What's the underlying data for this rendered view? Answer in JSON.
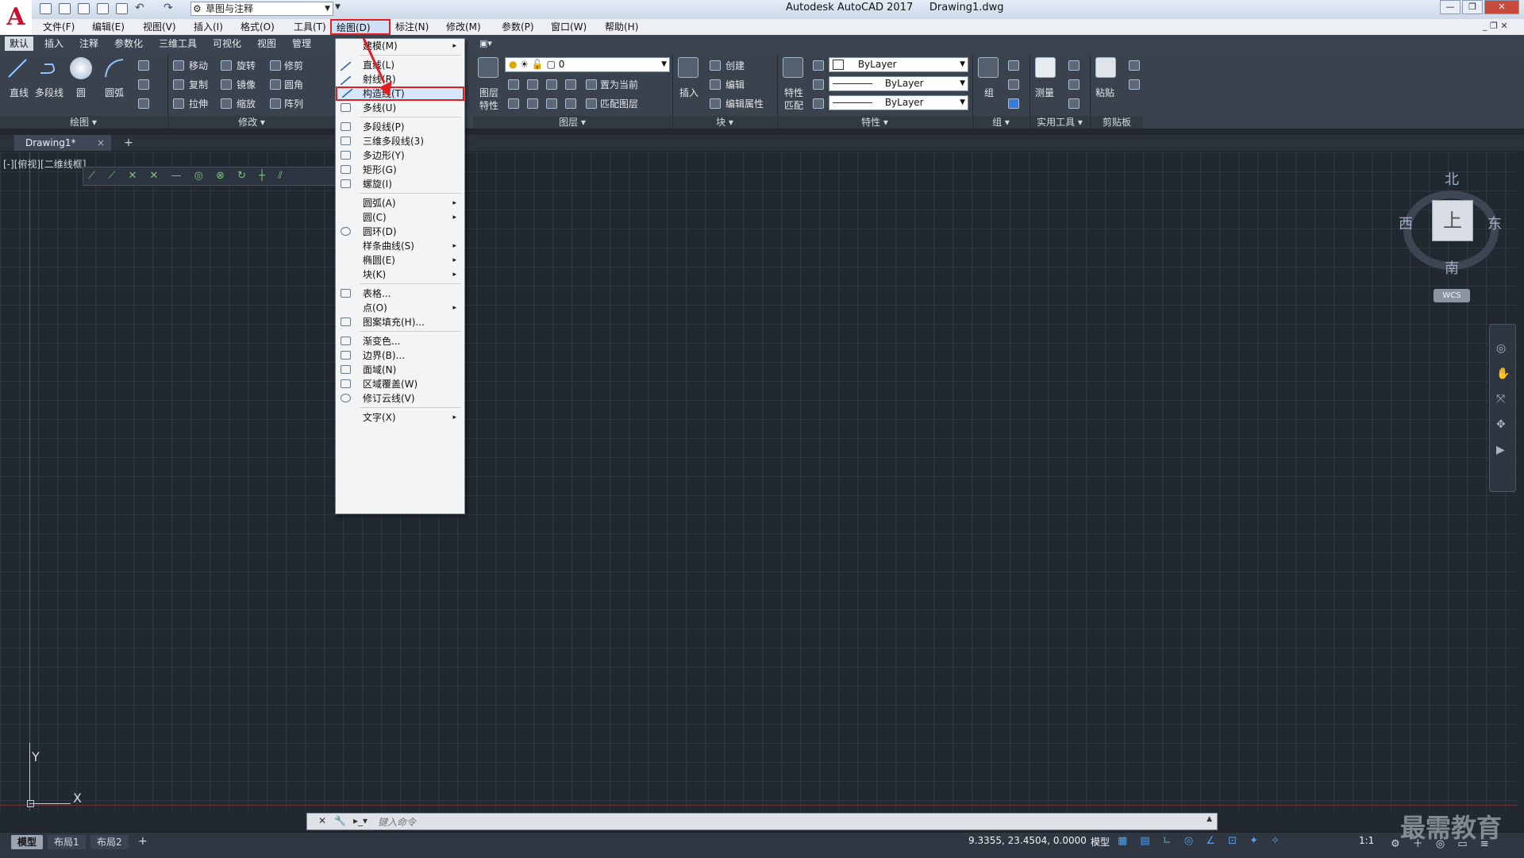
{
  "titlebar": {
    "app_logo": "A",
    "workspace": "草图与注释",
    "title": "Autodesk AutoCAD 2017     Drawing1.dwg"
  },
  "menubar": [
    "文件(F)",
    "编辑(E)",
    "视图(V)",
    "插入(I)",
    "格式(O)",
    "工具(T)",
    "绘图(D)",
    "标注(N)",
    "修改(M)",
    "参数(P)",
    "窗口(W)",
    "帮助(H)"
  ],
  "ribbon": {
    "tabs": [
      "默认",
      "插入",
      "注释",
      "参数化",
      "三维工具",
      "可视化",
      "视图",
      "管理"
    ],
    "draw": {
      "line": "直线",
      "pline": "多段线",
      "circle": "圆",
      "arc": "圆弧",
      "title": "绘图"
    },
    "modify": {
      "move": "移动",
      "rotate": "旋转",
      "trim": "修剪",
      "copy": "复制",
      "mirror": "镜像",
      "fillet": "圆角",
      "stretch": "拉伸",
      "scale": "缩放",
      "array": "阵列",
      "title": "修改"
    },
    "layers": {
      "layer_props_1": "图层",
      "layer_props_2": "特性",
      "current_layer": "0",
      "set_current": "置为当前",
      "match_layer": "匹配图层",
      "title": "图层"
    },
    "block": {
      "insert": "插入",
      "create": "创建",
      "edit": "编辑",
      "edit_attr": "编辑属性",
      "title": "块"
    },
    "properties": {
      "match_1": "特性",
      "match_2": "匹配",
      "color": "ByLayer",
      "linetype": "ByLayer",
      "lineweight": "ByLayer",
      "title": "特性"
    },
    "groups": {
      "group": "组",
      "title": "组"
    },
    "utilities": {
      "measure": "测量",
      "title": "实用工具"
    },
    "clipboard": {
      "paste": "粘贴",
      "title": "剪贴板"
    }
  },
  "doc_tab": {
    "name": "Drawing1*",
    "close": "×",
    "add": "+"
  },
  "viewport_label": "[-][俯视][二维线框]",
  "viewcube": {
    "face": "上",
    "north": "北",
    "south": "南",
    "east": "东",
    "west": "西",
    "wcs": "WCS"
  },
  "draw_menu": {
    "items": [
      {
        "label": "建模(M)",
        "sub": "▸"
      },
      {
        "label": "直线(L)"
      },
      {
        "label": "射线(R)"
      },
      {
        "label": "构造线(T)"
      },
      {
        "label": "多线(U)"
      },
      {
        "label": "多段线(P)"
      },
      {
        "label": "三维多段线(3)"
      },
      {
        "label": "多边形(Y)"
      },
      {
        "label": "矩形(G)"
      },
      {
        "label": "螺旋(I)"
      },
      {
        "label": "圆弧(A)",
        "sub": "▸"
      },
      {
        "label": "圆(C)",
        "sub": "▸"
      },
      {
        "label": "圆环(D)"
      },
      {
        "label": "样条曲线(S)",
        "sub": "▸"
      },
      {
        "label": "椭圆(E)",
        "sub": "▸"
      },
      {
        "label": "块(K)",
        "sub": "▸"
      },
      {
        "label": "表格..."
      },
      {
        "label": "点(O)",
        "sub": "▸"
      },
      {
        "label": "图案填充(H)..."
      },
      {
        "label": "渐变色..."
      },
      {
        "label": "边界(B)..."
      },
      {
        "label": "面域(N)"
      },
      {
        "label": "区域覆盖(W)"
      },
      {
        "label": "修订云线(V)"
      },
      {
        "label": "文字(X)",
        "sub": "▸"
      }
    ]
  },
  "ucs": {
    "x": "X",
    "y": "Y"
  },
  "command": {
    "placeholder": "键入命令"
  },
  "status": {
    "layouts": [
      "模型",
      "布局1",
      "布局2"
    ],
    "add_layout": "+",
    "coords": "9.3355, 23.4504, 0.0000",
    "mode": "模型",
    "scale": "1:1"
  },
  "watermark": "最需教育",
  "colors": {
    "highlight": "#e02020",
    "canvas": "#212830",
    "ribbon": "#3a424e"
  }
}
